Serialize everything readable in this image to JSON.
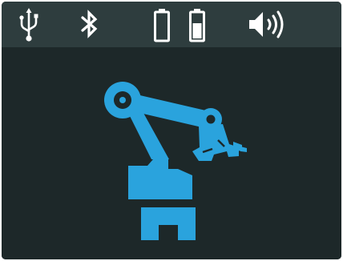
{
  "status_bar": {
    "icons": [
      "usb-icon",
      "bluetooth-icon",
      "battery-icon",
      "battery-icon",
      "volume-icon"
    ],
    "battery_1_level": 0,
    "battery_2_level": 0.6,
    "icon_color": "#ffffff",
    "background_color": "#2e3d3e"
  },
  "screen": {
    "graphic": "industrial-robot-arm-icon",
    "graphic_color": "#2aa3dd",
    "background_color": "#1d2829"
  }
}
